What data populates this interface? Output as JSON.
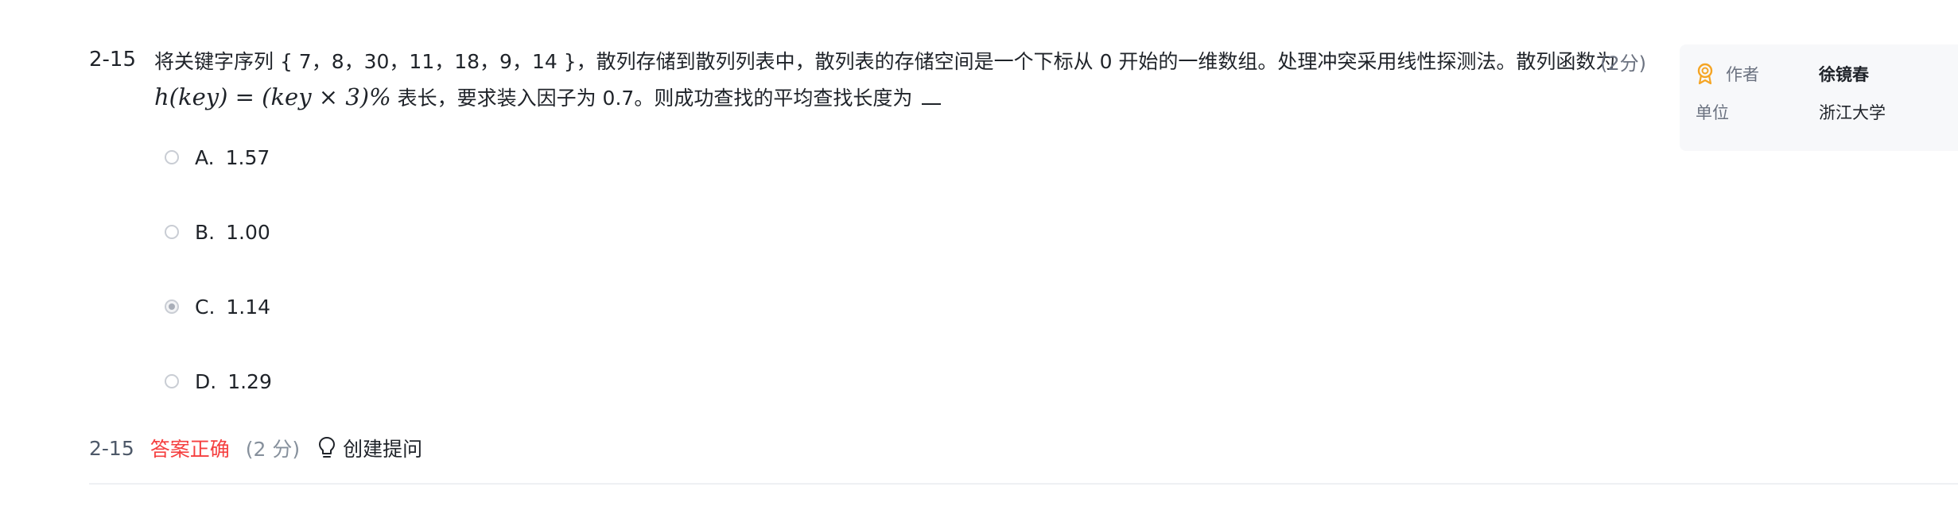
{
  "question": {
    "number": "2-15",
    "score": "(2分)",
    "text_part1": "将关键字序列 { 7，8，30，11，18，9，14 }，散列存储到散列列表中，散列表的存储空间是一个下标从 0 开始的一维数组。处理冲突采用线性探测法。散列函数为",
    "formula": "h(key) = (key × 3)%",
    "text_part2": "表长，要求装入因子为 0.7。则成功查找的平均查找长度为"
  },
  "options": [
    {
      "letter": "A.",
      "text": "1.57",
      "checked": false
    },
    {
      "letter": "B.",
      "text": "1.00",
      "checked": false
    },
    {
      "letter": "C.",
      "text": "1.14",
      "checked": true
    },
    {
      "letter": "D.",
      "text": "1.29",
      "checked": false
    }
  ],
  "author_card": {
    "author_label": "作者",
    "author_value": "徐镜春",
    "unit_label": "单位",
    "unit_value": "浙江大学"
  },
  "result": {
    "number": "2-15",
    "status": "答案正确",
    "score": "(2 分)",
    "ask_label": "创建提问"
  },
  "colors": {
    "status_red": "#f53f3f",
    "award_orange": "#f5a524",
    "card_bg": "#f7f8fa"
  }
}
